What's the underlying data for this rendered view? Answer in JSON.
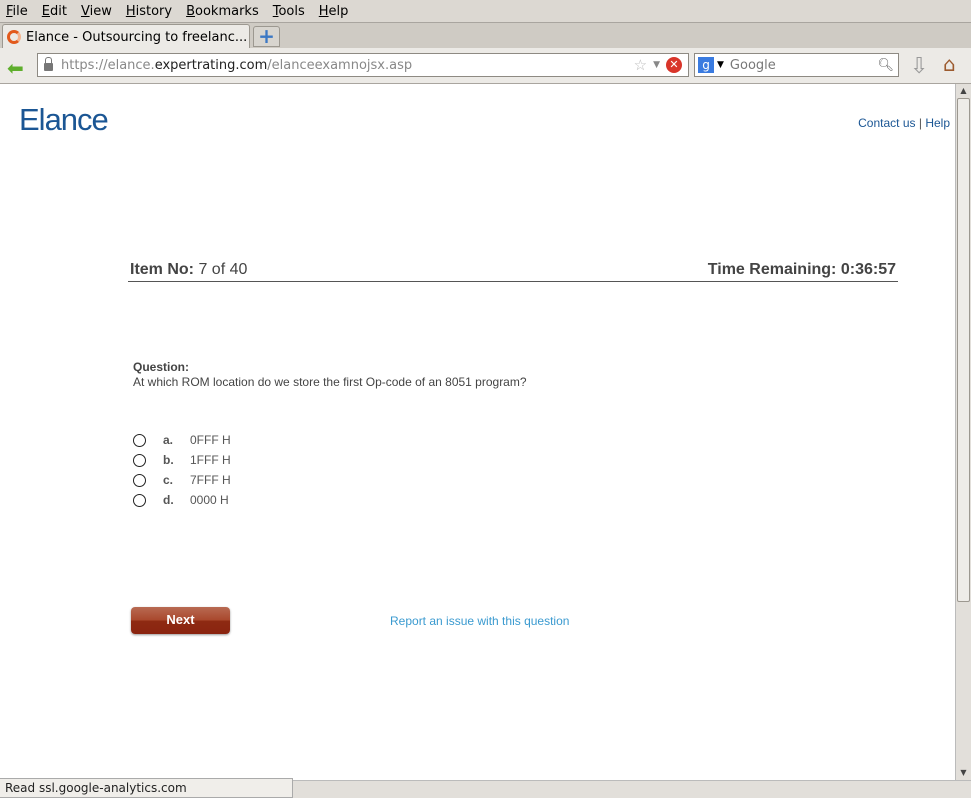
{
  "menu": [
    "File",
    "Edit",
    "View",
    "History",
    "Bookmarks",
    "Tools",
    "Help"
  ],
  "tab": {
    "title": "Elance - Outsourcing to freelanc..."
  },
  "url": {
    "scheme": "https://elance.",
    "domain": "expertrating.com",
    "path": "/elanceexamnojsx.asp"
  },
  "search": {
    "placeholder": "Google"
  },
  "page": {
    "logo": "Elance",
    "contact": "Contact us",
    "sep": "|",
    "help": "Help",
    "item_label": "Item No:",
    "item_value": "7 of 40",
    "time_label": "Time Remaining:",
    "time_value": "0:36:57",
    "question_label": "Question:",
    "question": "At which ROM location do we store the first Op-code of an 8051 program?",
    "options": [
      {
        "letter": "a.",
        "text": "0FFF H"
      },
      {
        "letter": "b.",
        "text": "1FFF H"
      },
      {
        "letter": "c.",
        "text": "7FFF H"
      },
      {
        "letter": "d.",
        "text": "0000 H"
      }
    ],
    "next": "Next",
    "report": "Report an issue with this question"
  },
  "status": "Read ssl.google-analytics.com",
  "colors": {
    "brand": "#1b5694",
    "button": "#a9472c",
    "link": "#3a9ad0"
  }
}
